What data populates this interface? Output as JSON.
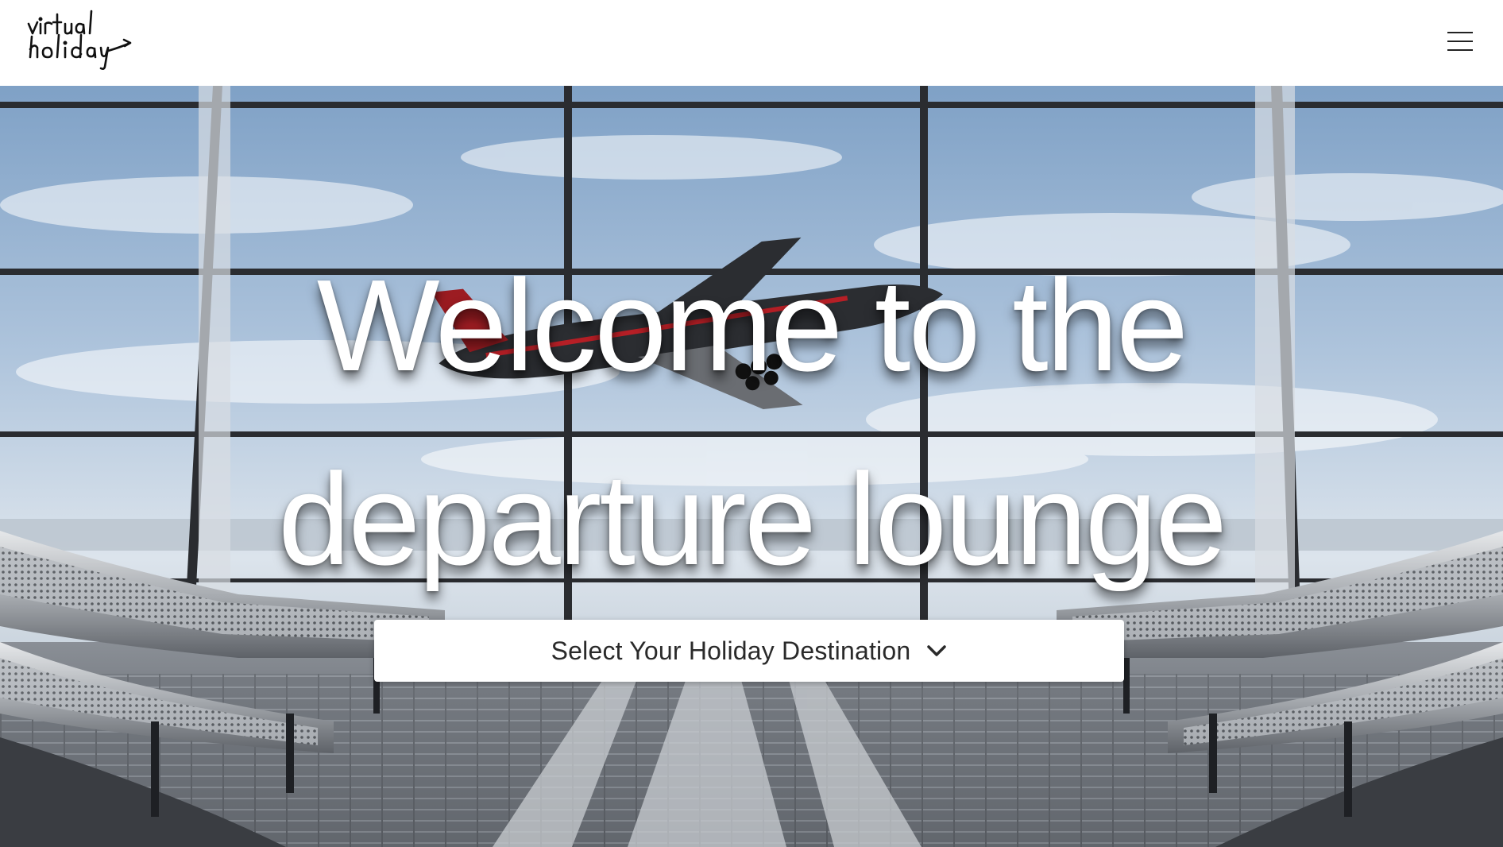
{
  "header": {
    "logo_text_line1": "virtual",
    "logo_text_line2": "holiday",
    "menu_icon": "hamburger-menu-icon"
  },
  "hero": {
    "headline": "Welcome to the departure lounge",
    "background": "airport departure lounge with airplane taking off",
    "destination_select": {
      "label": "Select Your Holiday Destination",
      "icon": "chevron-down-icon"
    }
  },
  "colors": {
    "header_bg": "#ffffff",
    "headline_text": "#ffffff",
    "select_bg": "#ffffff",
    "select_text": "#2a2a2a"
  }
}
